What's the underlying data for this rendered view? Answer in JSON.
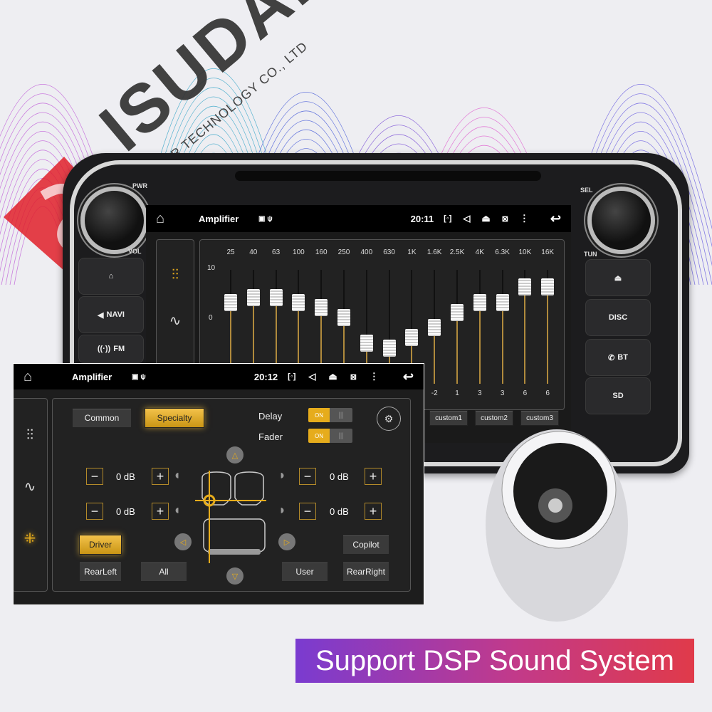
{
  "brand": {
    "logo_text": "ISUDAR",
    "subtitle": "ISUDAR TECHNOLOGY CO., LTD",
    "logo_color": "#e0202a"
  },
  "head_unit": {
    "pwr": "PWR",
    "vol": "VOL",
    "sel": "SEL",
    "tun": "TUN",
    "left_buttons": [
      {
        "icon": "home-icon",
        "label": ""
      },
      {
        "icon": "navi-icon",
        "label": "NAVI"
      },
      {
        "icon": "fm-icon",
        "label": "FM"
      }
    ],
    "right_buttons": [
      {
        "icon": "eject-icon",
        "label": ""
      },
      {
        "icon": "disc-icon",
        "label": "DISC"
      },
      {
        "icon": "phone-icon",
        "label": "BT"
      },
      {
        "icon": "sd-icon",
        "label": "SD"
      }
    ]
  },
  "back_screen": {
    "title": "Amplifier",
    "time": "20:11",
    "eq": {
      "bands": [
        "25",
        "40",
        "63",
        "100",
        "160",
        "250",
        "400",
        "630",
        "1K",
        "1.6K",
        "2.5K",
        "4K",
        "6.3K",
        "10K",
        "16K"
      ],
      "values": [
        3,
        4,
        4,
        3,
        2,
        0,
        -5,
        -6,
        -4,
        -2,
        1,
        3,
        3,
        6,
        6
      ],
      "visible_value_labels": [
        "",
        "",
        "",
        "",
        "",
        "",
        "",
        "",
        "",
        "-2",
        "1",
        "3",
        "3",
        "6",
        "6"
      ],
      "scale_top": "10",
      "scale_zero": "0",
      "range": [
        -10,
        10
      ]
    },
    "presets": [
      "custom1",
      "custom2",
      "custom3"
    ]
  },
  "front_screen": {
    "title": "Amplifier",
    "time": "20:12",
    "tabs": [
      {
        "label": "Common",
        "active": false
      },
      {
        "label": "Specialty",
        "active": true
      }
    ],
    "delay": {
      "label": "Delay",
      "state": "ON"
    },
    "fader": {
      "label": "Fader",
      "state": "ON"
    },
    "speakers": [
      {
        "value": "0 dB"
      },
      {
        "value": "0 dB"
      },
      {
        "value": "0 dB"
      },
      {
        "value": "0 dB"
      }
    ],
    "minus": "−",
    "plus": "+",
    "buttons": {
      "driver": "Driver",
      "copilot": "Copilot",
      "rear_left": "RearLeft",
      "all": "All",
      "user": "User",
      "rear_right": "RearRight"
    }
  },
  "accent": "#e6ac1c",
  "banner": {
    "text": "Support DSP Sound System"
  }
}
